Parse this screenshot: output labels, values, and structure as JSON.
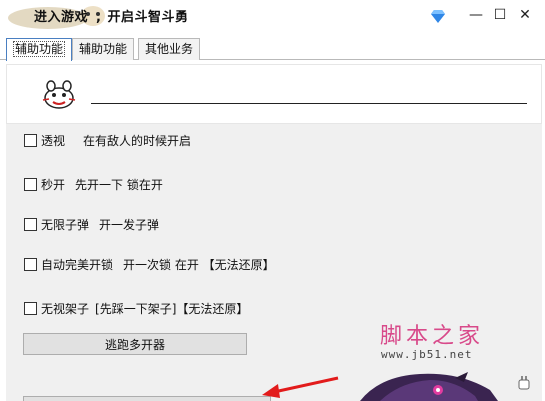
{
  "window": {
    "title_left": "进入游戏",
    "title_right": "开启斗智斗勇",
    "minimize_glyph": "—",
    "maximize_glyph": "☐",
    "close_glyph": "✕"
  },
  "tabs": [
    {
      "label": "辅助功能",
      "active": true
    },
    {
      "label": "辅助功能",
      "active": false
    },
    {
      "label": "其他业务",
      "active": false
    }
  ],
  "options": [
    {
      "label": "透视",
      "description": "在有敌人的时候开启",
      "checked": false
    },
    {
      "label": "秒开",
      "description": "先开一下 锁在开",
      "checked": false
    },
    {
      "label": "无限子弹",
      "description": "开一发子弹",
      "checked": false
    },
    {
      "label": "自动完美开锁",
      "description": "开一次锁 在开  【无法还原】",
      "checked": false
    },
    {
      "label": "无视架子",
      "description": "[先踩一下架子]【无法还原】",
      "checked": false
    }
  ],
  "buttons": {
    "escape": "逃跑多开器"
  },
  "watermark": {
    "site_cn": "脚本之家",
    "site_url": "www.jb51.net"
  },
  "icons": {
    "title_logo": "character-logo-icon",
    "diamond": "diamond-icon",
    "header_avatar": "cartoon-face-icon",
    "arrow": "red-arrow-icon",
    "plug": "plug-icon"
  },
  "colors": {
    "diamond": "#2f86e6",
    "arrow": "#e21b1b",
    "watermark": "#d84a8a"
  }
}
